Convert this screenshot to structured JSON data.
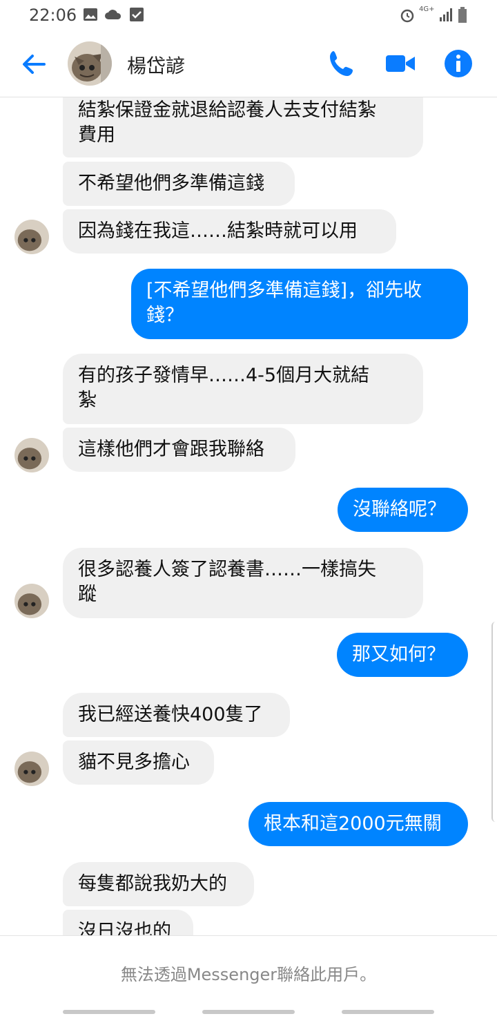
{
  "status_bar": {
    "time": "22:06",
    "network": "4G+"
  },
  "header": {
    "contact_name": "楊岱諺"
  },
  "messages": [
    {
      "dir": "in",
      "text": "結紮保證金就退給認養人去支付結紮\n費用"
    },
    {
      "dir": "in",
      "text": "不希望他們多準備這錢"
    },
    {
      "dir": "in",
      "text": "因為錢在我這……結紮時就可以用"
    },
    {
      "dir": "out",
      "text": "[不希望他們多準備這錢]，卻先收\n錢？"
    },
    {
      "dir": "in",
      "text": "有的孩子發情早……4-5個月大就結\n紮"
    },
    {
      "dir": "in",
      "text": "這樣他們才會跟我聯絡"
    },
    {
      "dir": "out",
      "text": "沒聯絡呢？"
    },
    {
      "dir": "in",
      "text": "很多認養人簽了認養書……一樣搞失\n蹤"
    },
    {
      "dir": "out",
      "text": "那又如何？"
    },
    {
      "dir": "in",
      "text": "我已經送養快400隻了"
    },
    {
      "dir": "in",
      "text": "貓不見多擔心"
    },
    {
      "dir": "out",
      "text": "根本和這2000元無關"
    },
    {
      "dir": "in",
      "text": "每隻都說我奶大的"
    },
    {
      "dir": "in",
      "text": "沒日沒也的"
    }
  ],
  "footer": {
    "notice": "無法透過Messenger聯絡此用戶。"
  },
  "colors": {
    "accent": "#0084ff",
    "incoming_bubble": "#f0f0f0",
    "header_icon": "#0a7cff"
  },
  "icons": [
    "back-arrow-icon",
    "phone-icon",
    "video-camera-icon",
    "info-icon"
  ]
}
